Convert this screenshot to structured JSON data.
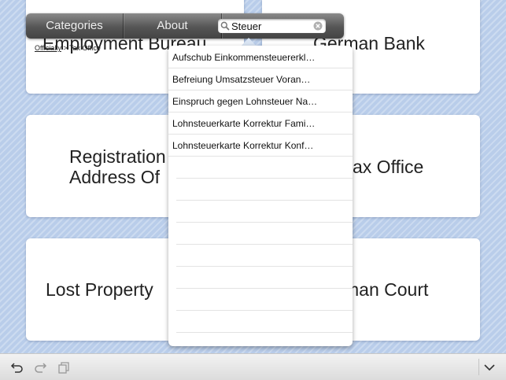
{
  "cards": {
    "employment_bureau": "Employment Bureau",
    "german_bank": "German Bank",
    "registration_line1": "Registration",
    "registration_line2": "Address Of",
    "tax_office": "ax Office",
    "lost_property": "Lost Property",
    "german_court": "man Court"
  },
  "toolbar": {
    "categories_label": "Categories",
    "about_label": "About",
    "search_value": "Steuer"
  },
  "breadcrumb": {
    "link": "Officially",
    "separator": ">",
    "current": "Tax Office"
  },
  "search_results": [
    "Aufschub Einkommensteuererkl…",
    "Befreiung Umsatzsteuer Voran…",
    "Einspruch gegen Lohnsteuer Na…",
    "Lohnsteuerkarte Korrektur Fami…",
    "Lohnsteuerkarte Korrektur Konf…"
  ],
  "icons": {
    "search": "magnifier",
    "clear": "x-circle",
    "undo": "undo-arrow",
    "redo": "redo-arrow",
    "copy": "copy",
    "collapse": "chevron-down"
  }
}
